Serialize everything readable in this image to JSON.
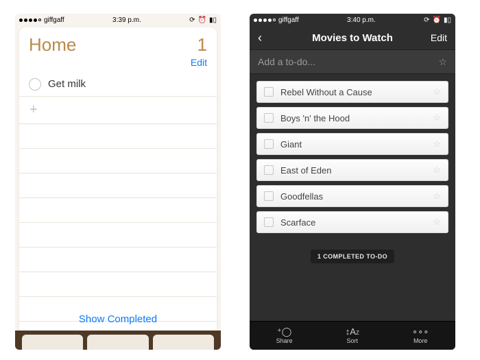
{
  "left": {
    "status": {
      "carrier": "giffgaff",
      "time": "3:39 p.m."
    },
    "title": "Home",
    "count": "1",
    "edit": "Edit",
    "reminders": [
      {
        "text": "Get milk"
      }
    ],
    "show_completed": "Show Completed"
  },
  "right": {
    "status": {
      "carrier": "giffgaff",
      "time": "3:40 p.m."
    },
    "nav": {
      "title": "Movies to Watch",
      "edit": "Edit"
    },
    "add_placeholder": "Add a to-do...",
    "todos": [
      {
        "text": "Rebel Without a Cause"
      },
      {
        "text": "Boys 'n' the Hood"
      },
      {
        "text": "Giant"
      },
      {
        "text": "East of Eden"
      },
      {
        "text": "Goodfellas"
      },
      {
        "text": "Scarface"
      }
    ],
    "completed_badge": "1 COMPLETED TO-DO",
    "tabs": {
      "share": "Share",
      "sort": "Sort",
      "more": "More"
    }
  }
}
